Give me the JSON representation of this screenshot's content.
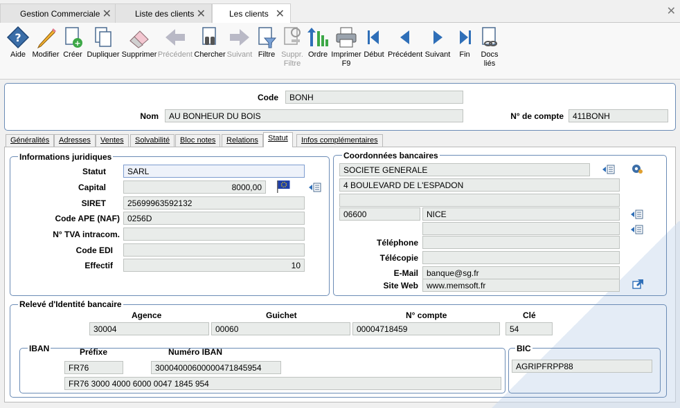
{
  "doc_tabs": [
    {
      "label": "Gestion Commerciale"
    },
    {
      "label": "Liste des clients"
    },
    {
      "label": "Les clients"
    }
  ],
  "toolbar": {
    "aide": "Aide",
    "modifier": "Modifier",
    "creer": "Créer",
    "dupliquer": "Dupliquer",
    "supprimer": "Supprimer",
    "precedent_disabled": "Précédent",
    "chercher": "Chercher",
    "suivant_disabled": "Suivant",
    "filtre": "Filtre",
    "suppr_filtre_1": "Suppr.",
    "suppr_filtre_2": "Filtre",
    "ordre": "Ordre",
    "imprimer_1": "Imprimer",
    "imprimer_2": "F9",
    "debut": "Début",
    "precedent": "Précédent",
    "suivant": "Suivant",
    "fin": "Fin",
    "docs_1": "Docs",
    "docs_2": "liés"
  },
  "header": {
    "code_label": "Code",
    "code_value": "BONH",
    "nom_label": "Nom",
    "nom_value": "AU BONHEUR DU BOIS",
    "compte_label": "N° de compte",
    "compte_value": "411BONH"
  },
  "tabs": [
    {
      "label": "Généralités"
    },
    {
      "label": "Adresses"
    },
    {
      "label": "Ventes"
    },
    {
      "label": "Solvabilité"
    },
    {
      "label": "Bloc notes"
    },
    {
      "label": "Relations"
    },
    {
      "label": "Statut"
    },
    {
      "label": "Infos complémentaires"
    }
  ],
  "juridique": {
    "title": "Informations juridiques",
    "statut_label": "Statut",
    "statut_value": "SARL",
    "capital_label": "Capital",
    "capital_value": "8000,00",
    "siret_label": "SIRET",
    "siret_value": "25699963592132",
    "ape_label": "Code APE (NAF)",
    "ape_value": "0256D",
    "tva_label": "N° TVA intracom.",
    "tva_value": "",
    "edi_label": "Code EDI",
    "edi_value": "",
    "effectif_label": "Effectif",
    "effectif_value": "10"
  },
  "banque": {
    "title": "Coordonnées bancaires",
    "nom": "SOCIETE GENERALE",
    "adresse1": "4 BOULEVARD DE L'ESPADON",
    "adresse2": "",
    "cp": "06600",
    "ville": "NICE",
    "extra": "",
    "telephone_label": "Téléphone",
    "telephone_value": "",
    "telecopie_label": "Télécopie",
    "telecopie_value": "",
    "email_label": "E-Mail",
    "email_value": "banque@sg.fr",
    "site_label": "Site Web",
    "site_value": "www.memsoft.fr"
  },
  "rib": {
    "title": "Relevé d'Identité bancaire",
    "agence_label": "Agence",
    "agence_value": "30004",
    "guichet_label": "Guichet",
    "guichet_value": "00060",
    "compte_label": "N° compte",
    "compte_value": "00004718459",
    "cle_label": "Clé",
    "cle_value": "54"
  },
  "iban": {
    "title": "IBAN",
    "prefixe_label": "Préfixe",
    "prefixe_value": "FR76",
    "numero_label": "Numéro IBAN",
    "numero_value": "30004000600000471845954",
    "full_value": "FR76  3000  4000  6000  0047  1845  954"
  },
  "bic": {
    "title": "BIC",
    "value": "AGRIPFRPP88"
  }
}
